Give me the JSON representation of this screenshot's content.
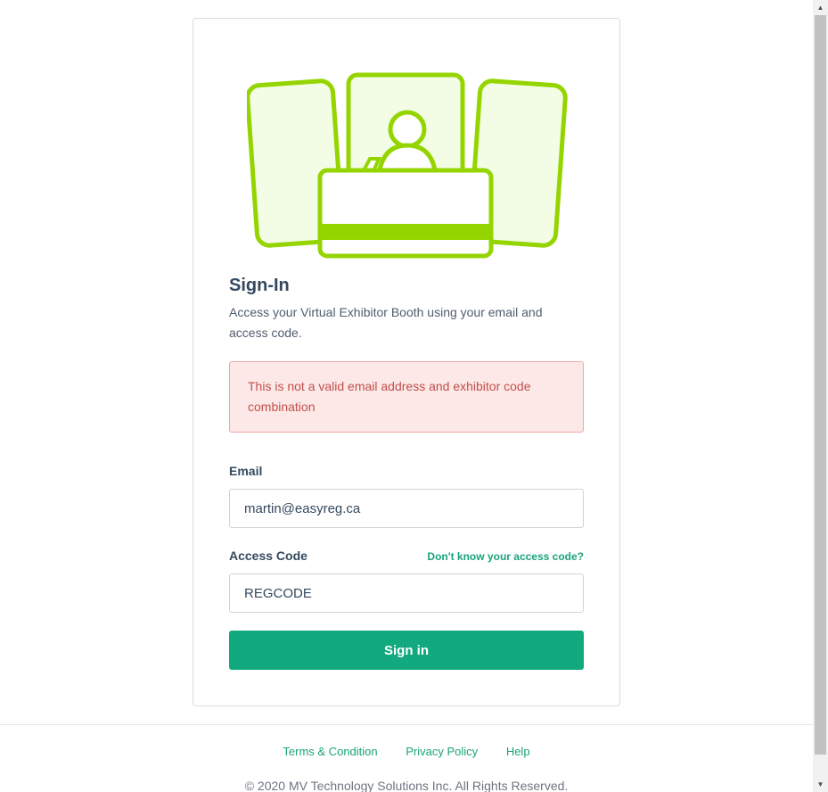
{
  "signin": {
    "title": "Sign-In",
    "subtitle": "Access your Virtual Exhibitor Booth using your email and access code.",
    "error": "This is not a valid email address and exhibitor code combination",
    "email_label": "Email",
    "email_value": "martin@easyreg.ca",
    "code_label": "Access Code",
    "forgot_link": "Don't know your access code?",
    "code_value": "REGCODE",
    "submit": "Sign in"
  },
  "footer": {
    "links": [
      "Terms & Condition",
      "Privacy Policy",
      "Help"
    ],
    "copyright": "© 2020 MV Technology Solutions Inc. All Rights Reserved."
  },
  "colors": {
    "accent": "#12a97f",
    "illustration": "#94d500",
    "error_bg": "#fce8e6",
    "error_text": "#c0504d"
  },
  "icons": {
    "illustration": "exhibitor-booth-icon",
    "scroll_up": "scroll-up-arrow-icon",
    "scroll_down": "scroll-down-arrow-icon"
  }
}
